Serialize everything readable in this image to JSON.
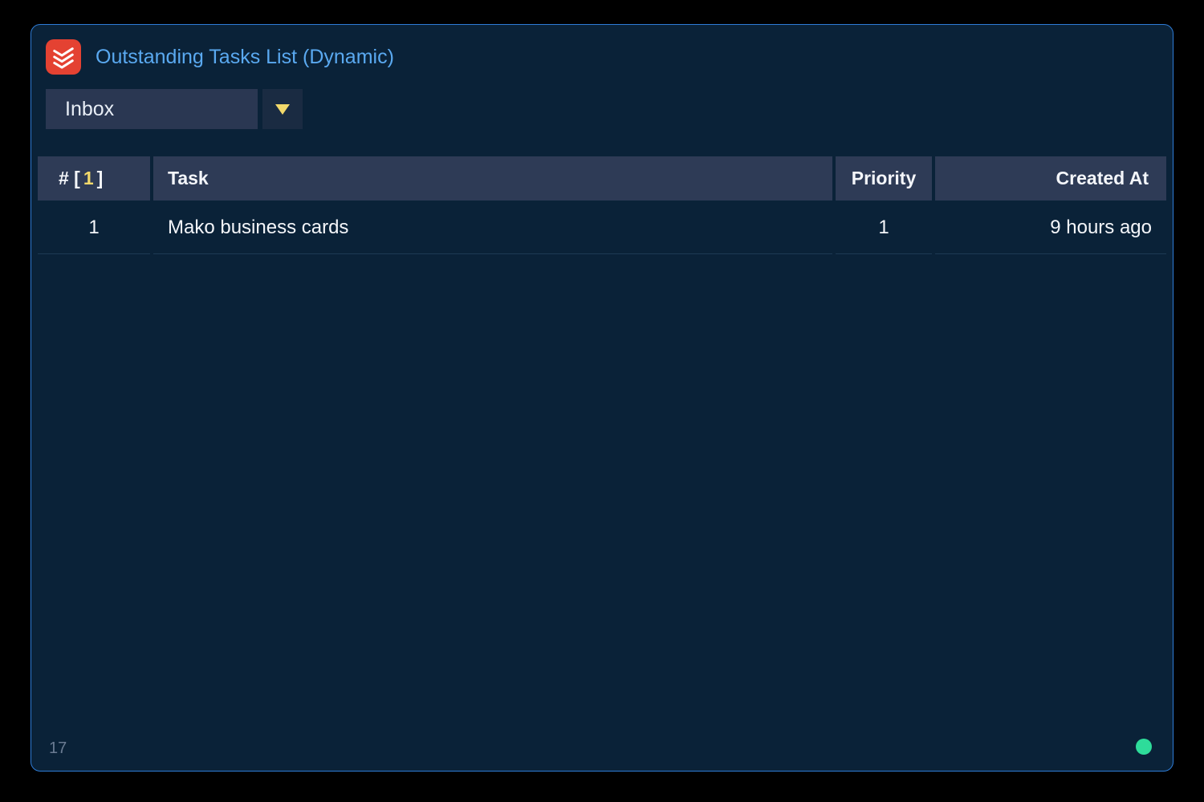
{
  "header": {
    "title": "Outstanding Tasks List (Dynamic)",
    "app_icon_name": "todoist-icon"
  },
  "filter": {
    "selected": "Inbox"
  },
  "table": {
    "count": "1",
    "columns": {
      "num_prefix": "# [",
      "num_suffix": "]",
      "task": "Task",
      "priority": "Priority",
      "created_at": "Created At"
    },
    "rows": [
      {
        "num": "1",
        "task": "Mako business cards",
        "priority": "1",
        "created": "9 hours ago"
      }
    ]
  },
  "footer": {
    "page_number": "17"
  },
  "colors": {
    "panel_bg": "#0a2238",
    "panel_border": "#2e7cd6",
    "header_accent": "#5aa9f0",
    "icon_bg": "#e44232",
    "th_bg": "#2e3b56",
    "highlight": "#f2d96b",
    "status_ok": "#2edc9a"
  }
}
